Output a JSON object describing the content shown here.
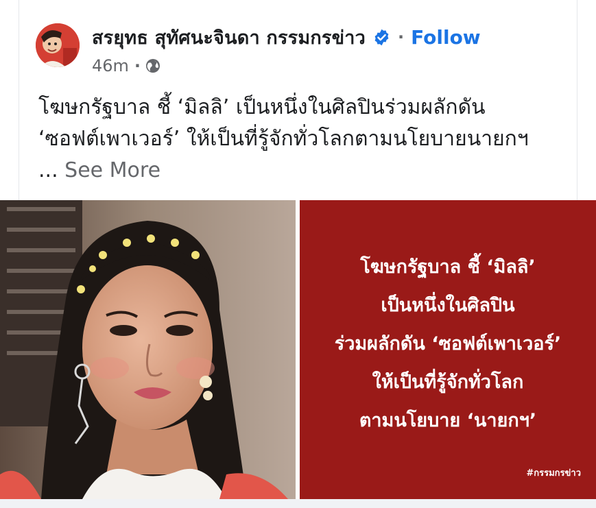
{
  "post": {
    "author": "สรยุทธ สุทัศนะจินดา กรรมกรข่าว",
    "follow_label": "Follow",
    "time": "46m",
    "text_lines": [
      "โฆษกรัฐบาล ชี้ ‘มิลลิ’ เป็นหนึ่งในศิลปินร่วมผลักดัน",
      "‘ซอฟต์เพาเวอร์’ ให้เป็นที่รู้จักทั่วโลกตามนโยบายนายกฯ"
    ],
    "ellipsis": "...",
    "see_more_label": "See More"
  },
  "image_panel": {
    "lines": [
      "โฆษกรัฐบาล ชี้ ‘มิลลิ’",
      "เป็นหนึ่งในศิลปิน",
      "ร่วมผลักดัน ‘ซอฟต์เพาเวอร์’",
      "ให้เป็นที่รู้จักทั่วโลก",
      "ตามนโยบาย ‘นายกฯ’"
    ],
    "hashtag": "#กรรมกรข่าว"
  },
  "colors": {
    "accent": "#1b74e4",
    "panel_background": "#9a1a18",
    "secondary_text": "#65676b"
  },
  "icons": [
    "verified-badge-icon",
    "globe-icon"
  ]
}
